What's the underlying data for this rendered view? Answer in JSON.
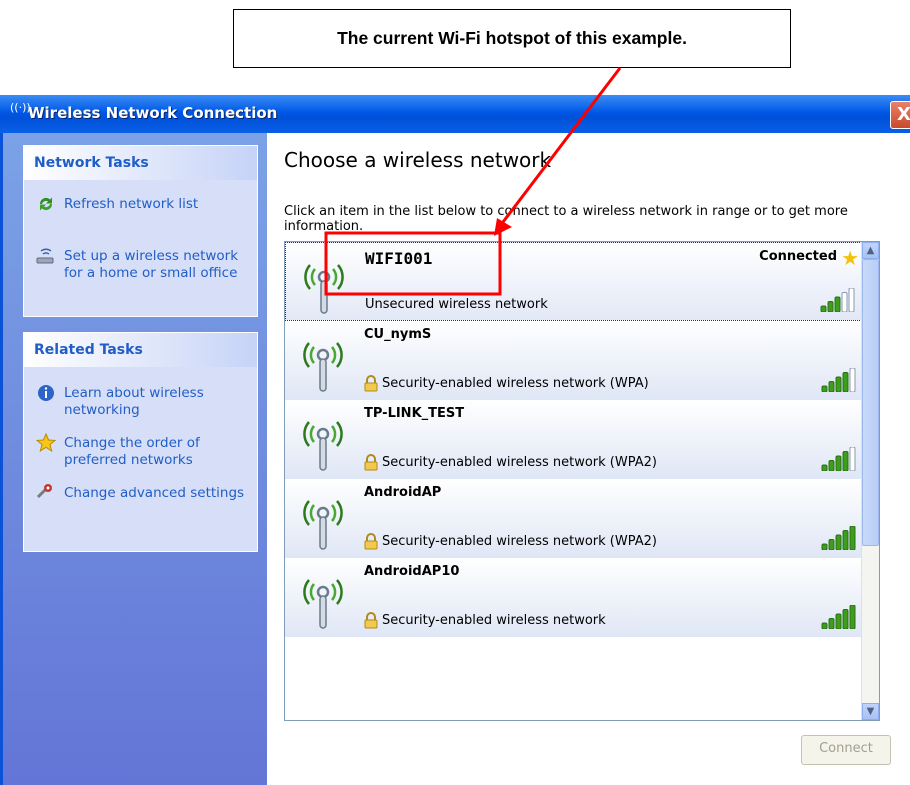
{
  "annotation": {
    "callout_text": "The current Wi-Fi hotspot of this example."
  },
  "window": {
    "title": "Wireless Network Connection",
    "title_icon": "wireless-signal-icon",
    "close_label": "X"
  },
  "sidebar": {
    "network_tasks": {
      "header": "Network Tasks",
      "items": [
        {
          "label": "Refresh network list",
          "icon": "refresh-icon"
        },
        {
          "label": "Set up a wireless network for a home or small office",
          "icon": "wireless-setup-icon"
        }
      ]
    },
    "related_tasks": {
      "header": "Related Tasks",
      "items": [
        {
          "label": "Learn about wireless networking",
          "icon": "info-icon"
        },
        {
          "label": "Change the order of preferred networks",
          "icon": "star-icon"
        },
        {
          "label": "Change advanced settings",
          "icon": "settings-icon"
        }
      ]
    }
  },
  "main": {
    "heading": "Choose a wireless network",
    "info": "Click an item in the list below to connect to a wireless network in range or to get more information.",
    "networks": [
      {
        "name": "WIFI001",
        "security": "Unsecured wireless network",
        "status": "Connected",
        "signal_bars": 5,
        "signal_level_filled": 3,
        "locked": false
      },
      {
        "name": "CU_nymS",
        "security": "Security-enabled wireless network (WPA)",
        "status": "",
        "signal_bars": 5,
        "signal_level_filled": 4,
        "locked": true
      },
      {
        "name": "TP-LINK_TEST",
        "security": "Security-enabled wireless network (WPA2)",
        "status": "",
        "signal_bars": 5,
        "signal_level_filled": 4,
        "locked": true
      },
      {
        "name": "AndroidAP",
        "security": "Security-enabled wireless network (WPA2)",
        "status": "",
        "signal_bars": 5,
        "signal_level_filled": 5,
        "locked": true
      },
      {
        "name": "AndroidAP10",
        "security": "Security-enabled wireless network",
        "status": "",
        "signal_bars": 5,
        "signal_level_filled": 5,
        "locked": true
      }
    ],
    "connect_label": "Connect"
  },
  "colors": {
    "title_bar": "#0058e6",
    "sidebar": "#7ba2e7",
    "task_link": "#215dc6",
    "signal_green": "#3c9d1f",
    "annotation_red": "#ff0000"
  }
}
